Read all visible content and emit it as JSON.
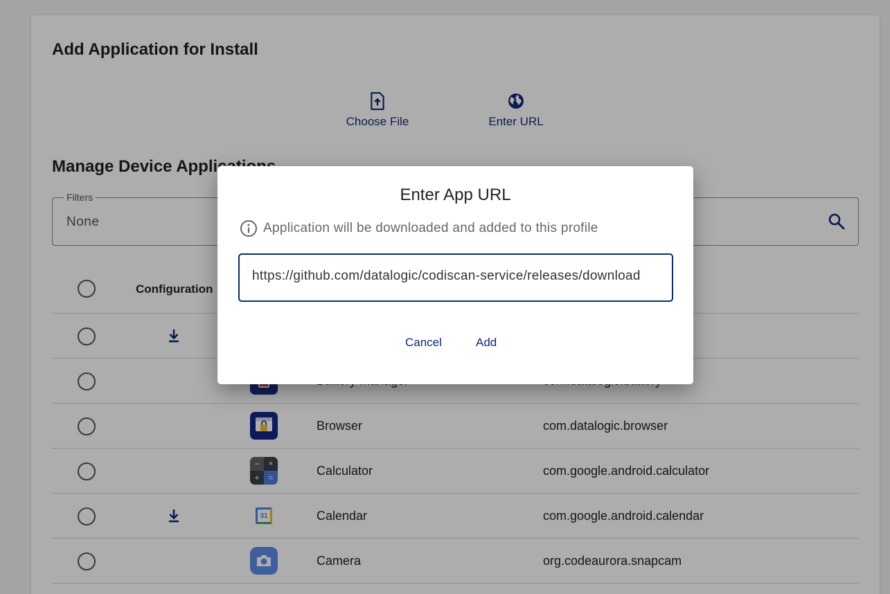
{
  "add_section": {
    "title": "Add Application for Install",
    "choose_file_label": "Choose File",
    "enter_url_label": "Enter URL"
  },
  "manage_section": {
    "title": "Manage Device Applications",
    "filters_legend": "Filters",
    "filters_value": "None",
    "column_configuration": "Configuration"
  },
  "apps": [
    {
      "name": "",
      "package": "",
      "has_download": true,
      "icon": "app-icon"
    },
    {
      "name": "Battery Manager",
      "package": "com.datalogic.battery",
      "has_download": false,
      "icon": "battery-manager-icon"
    },
    {
      "name": "Browser",
      "package": "com.datalogic.browser",
      "has_download": false,
      "icon": "browser-icon"
    },
    {
      "name": "Calculator",
      "package": "com.google.android.calculator",
      "has_download": false,
      "icon": "calculator-icon"
    },
    {
      "name": "Calendar",
      "package": "com.google.android.calendar",
      "has_download": true,
      "icon": "calendar-icon"
    },
    {
      "name": "Camera",
      "package": "org.codeaurora.snapcam",
      "has_download": false,
      "icon": "camera-icon"
    }
  ],
  "dialog": {
    "title": "Enter App URL",
    "info": "Application will be downloaded and added to this profile",
    "url_value": "https://github.com/datalogic/codiscan-service/releases/download",
    "cancel_label": "Cancel",
    "add_label": "Add",
    "calendar_day": "31"
  },
  "colors": {
    "accent": "#0a2a7a",
    "overlay": "rgba(0,0,0,0.32)"
  }
}
